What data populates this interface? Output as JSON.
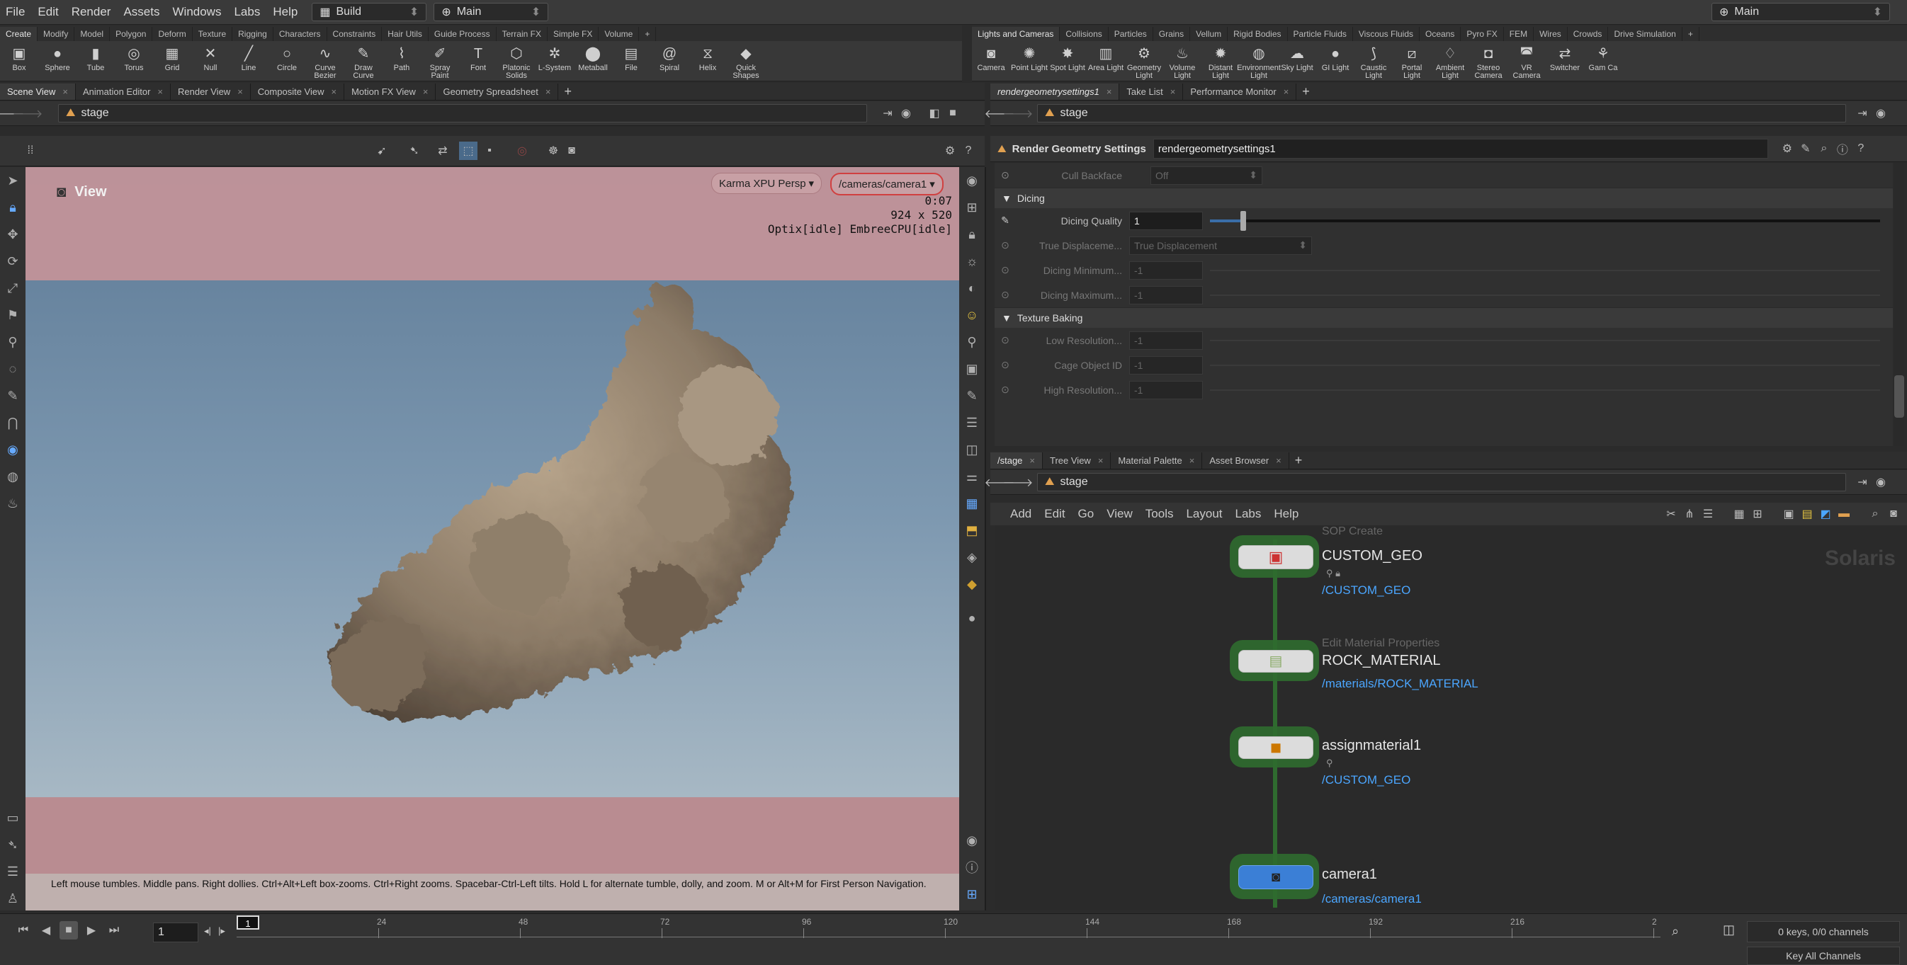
{
  "menubar": {
    "items": [
      "File",
      "Edit",
      "Render",
      "Assets",
      "Windows",
      "Labs",
      "Help"
    ],
    "desktop": "Build",
    "context": "Main",
    "right_context": "Main"
  },
  "shelf_left": {
    "tabs": [
      "Create",
      "Modify",
      "Model",
      "Polygon",
      "Deform",
      "Texture",
      "Rigging",
      "Characters",
      "Constraints",
      "Hair Utils",
      "Guide Process",
      "Terrain FX",
      "Simple FX",
      "Volume"
    ],
    "tools": [
      {
        "label": "Box",
        "icon": "▣"
      },
      {
        "label": "Sphere",
        "icon": "●"
      },
      {
        "label": "Tube",
        "icon": "▮"
      },
      {
        "label": "Torus",
        "icon": "◎"
      },
      {
        "label": "Grid",
        "icon": "▦"
      },
      {
        "label": "Null",
        "icon": "✕"
      },
      {
        "label": "Line",
        "icon": "╱"
      },
      {
        "label": "Circle",
        "icon": "○"
      },
      {
        "label": "Curve Bezier",
        "icon": "∿"
      },
      {
        "label": "Draw Curve",
        "icon": "✎"
      },
      {
        "label": "Path",
        "icon": "⌇"
      },
      {
        "label": "Spray Paint",
        "icon": "✐"
      },
      {
        "label": "Font",
        "icon": "T"
      },
      {
        "label": "Platonic Solids",
        "icon": "⬡"
      },
      {
        "label": "L-System",
        "icon": "✲"
      },
      {
        "label": "Metaball",
        "icon": "⬤"
      },
      {
        "label": "File",
        "icon": "▤"
      },
      {
        "label": "Spiral",
        "icon": "@"
      },
      {
        "label": "Helix",
        "icon": "⧖"
      },
      {
        "label": "Quick Shapes",
        "icon": "◆"
      }
    ]
  },
  "shelf_right": {
    "tabs": [
      "Lights and Cameras",
      "Collisions",
      "Particles",
      "Grains",
      "Vellum",
      "Rigid Bodies",
      "Particle Fluids",
      "Viscous Fluids",
      "Oceans",
      "Pyro FX",
      "FEM",
      "Wires",
      "Crowds",
      "Drive Simulation"
    ],
    "tools": [
      {
        "label": "Camera",
        "icon": "◙"
      },
      {
        "label": "Point Light",
        "icon": "✺"
      },
      {
        "label": "Spot Light",
        "icon": "✸"
      },
      {
        "label": "Area Light",
        "icon": "▥"
      },
      {
        "label": "Geometry Light",
        "icon": "⚙"
      },
      {
        "label": "Volume Light",
        "icon": "♨"
      },
      {
        "label": "Distant Light",
        "icon": "✹"
      },
      {
        "label": "Environment Light",
        "icon": "◍"
      },
      {
        "label": "Sky Light",
        "icon": "☁"
      },
      {
        "label": "GI Light",
        "icon": "●"
      },
      {
        "label": "Caustic Light",
        "icon": "⟆"
      },
      {
        "label": "Portal Light",
        "icon": "⧄"
      },
      {
        "label": "Ambient Light",
        "icon": "♢"
      },
      {
        "label": "Stereo Camera",
        "icon": "◘"
      },
      {
        "label": "VR Camera",
        "icon": "◚"
      },
      {
        "label": "Switcher",
        "icon": "⇄"
      },
      {
        "label": "Gam Ca",
        "icon": "⚘"
      }
    ]
  },
  "left_pane": {
    "tabs": [
      "Scene View",
      "Animation Editor",
      "Render View",
      "Composite View",
      "Motion FX View",
      "Geometry Spreadsheet"
    ],
    "path": "stage",
    "view_label": "View",
    "renderer": "Karma XPU Persp",
    "camera": "/cameras/camera1",
    "time": "0:07",
    "resolution": "924 x 520",
    "status": "Optix[idle] EmbreeCPU[idle]",
    "help_text": "Left mouse tumbles. Middle pans. Right dollies. Ctrl+Alt+Left box-zooms. Ctrl+Right zooms. Spacebar-Ctrl-Left tilts. Hold L for alternate tumble, dolly, and zoom. M or Alt+M for First Person Navigation."
  },
  "right_top": {
    "tabs": [
      "rendergeometrysettings1",
      "Take List",
      "Performance Monitor"
    ],
    "path": "stage",
    "node_type": "Render Geometry Settings",
    "node_name": "rendergeometrysettings1",
    "params": {
      "cull_label": "Cull Backface",
      "cull_value": "Off",
      "dicing_section": "Dicing",
      "quality_label": "Dicing Quality",
      "quality_value": "1",
      "true_disp_label": "True Displaceme...",
      "true_disp_value": "True Displacement",
      "dmin_label": "Dicing Minimum...",
      "dmin_value": "-1",
      "dmax_label": "Dicing Maximum...",
      "dmax_value": "-1",
      "baking_section": "Texture Baking",
      "lowres_label": "Low Resolution...",
      "lowres_value": "-1",
      "cage_label": "Cage Object ID",
      "cage_value": "-1",
      "highres_label": "High Resolution...",
      "highres_value": "-1"
    },
    "quality_fraction": 0.05
  },
  "network": {
    "tabs": [
      "/stage",
      "Tree View",
      "Material Palette",
      "Asset Browser"
    ],
    "path": "stage",
    "menu": [
      "Add",
      "Edit",
      "Go",
      "View",
      "Tools",
      "Layout",
      "Labs",
      "Help"
    ],
    "watermark": "Solaris",
    "nodes": [
      {
        "type": "SOP Create",
        "name": "CUSTOM_GEO",
        "path": "/CUSTOM_GEO"
      },
      {
        "type": "Edit Material Properties",
        "name": "ROCK_MATERIAL",
        "path": "/materials/ROCK_MATERIAL"
      },
      {
        "type": "",
        "name": "assignmaterial1",
        "path": "/CUSTOM_GEO"
      },
      {
        "type": "",
        "name": "camera1",
        "path": "/cameras/camera1"
      }
    ]
  },
  "timeline": {
    "frame": "1",
    "start_marker": "1",
    "ticks": [
      "24",
      "48",
      "72",
      "96",
      "120",
      "144",
      "168",
      "192",
      "216",
      "2"
    ],
    "keys_info": "0 keys, 0/0 channels",
    "key_all": "Key All Channels"
  },
  "colors": {
    "accent": "#4ba6ff",
    "node_wire": "#2f6b2f",
    "mask": "#c49399"
  }
}
